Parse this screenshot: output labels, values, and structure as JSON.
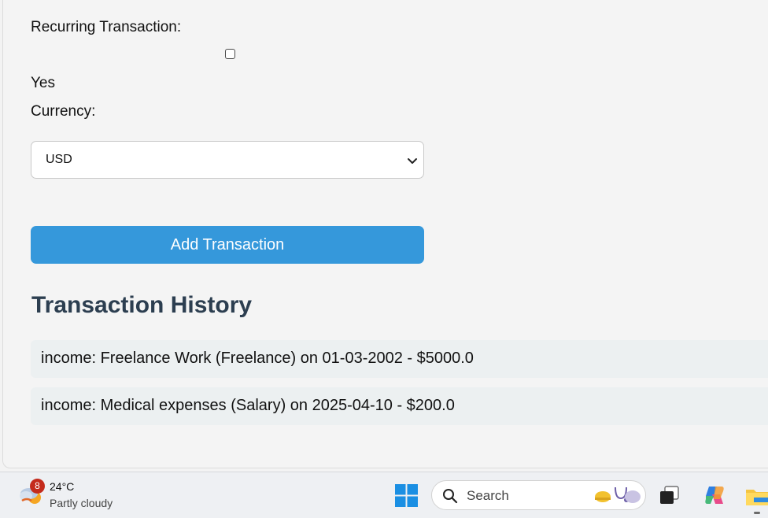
{
  "form": {
    "recurring_label": "Recurring Transaction:",
    "recurring_checked": false,
    "recurring_option_label": "Yes",
    "currency_label": "Currency:",
    "currency_value": "USD",
    "submit_label": "Add Transaction"
  },
  "history": {
    "title": "Transaction History",
    "items": [
      "income: Freelance Work (Freelance) on 01-03-2002 - $5000.0",
      "income: Medical expenses (Salary) on 2025-04-10 - $200.0"
    ]
  },
  "taskbar": {
    "weather_badge": "8",
    "weather_temp": "24°C",
    "weather_condition": "Partly cloudy",
    "search_placeholder": "Search"
  },
  "colors": {
    "accent": "#3598db",
    "heading": "#2c3e50",
    "history_item_bg": "#ecf0f1",
    "badge": "#c42b1c"
  }
}
